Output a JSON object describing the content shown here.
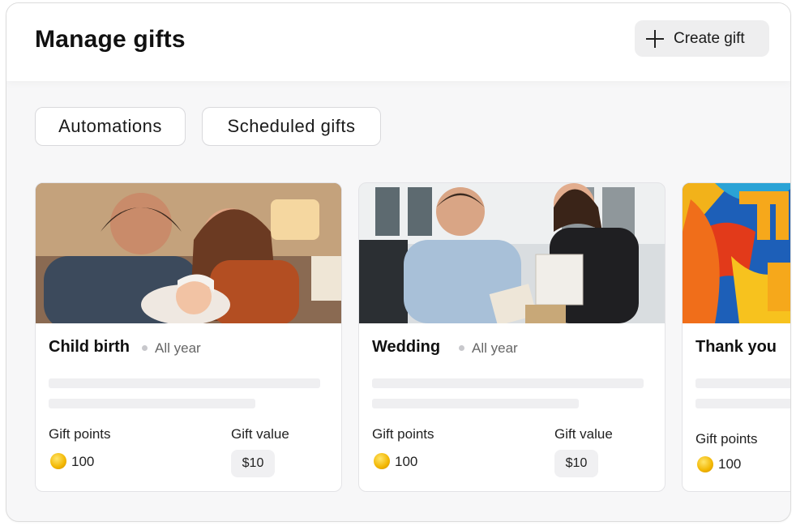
{
  "header": {
    "title": "Manage gifts",
    "create_label": "Create gift"
  },
  "tabs": [
    {
      "label": "Automations"
    },
    {
      "label": "Scheduled gifts"
    }
  ],
  "cards": [
    {
      "title": "Child birth",
      "period": "All year",
      "points_label": "Gift points",
      "points": "100",
      "value_label": "Gift value",
      "value": "$10"
    },
    {
      "title": "Wedding",
      "period": "All year",
      "points_label": "Gift points",
      "points": "100",
      "value_label": "Gift value",
      "value": "$10"
    },
    {
      "title": "Thank you",
      "points_label": "Gift points",
      "points": "100"
    }
  ],
  "colors": {
    "accent_coin": "#f2b600",
    "panel_bg": "#f7f7f8",
    "chip_border": "#d9d9dc"
  },
  "icons": {
    "create": "plus-icon",
    "points": "coin-icon"
  }
}
